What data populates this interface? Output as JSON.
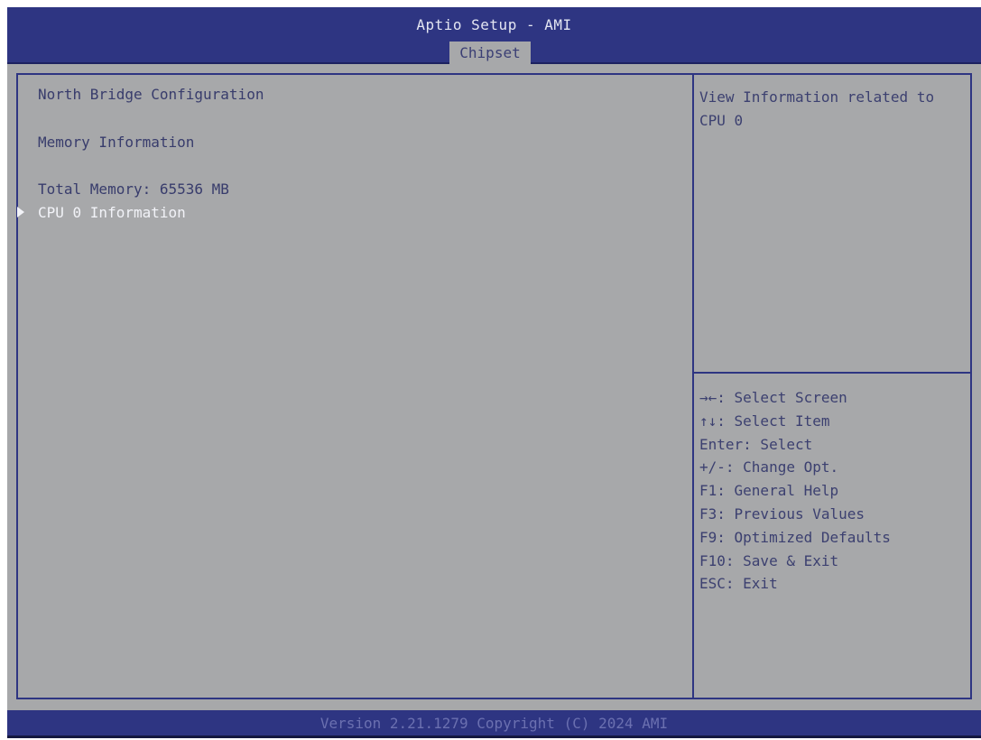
{
  "header": {
    "title": "Aptio Setup - AMI",
    "active_tab": "Chipset"
  },
  "left": {
    "items": [
      {
        "label": "North Bridge Configuration"
      },
      {
        "label": "Memory Information"
      },
      {
        "label": "Total Memory: 65536 MB"
      },
      {
        "label": "CPU 0 Information",
        "selected": true
      }
    ]
  },
  "help": {
    "text": "View Information related to CPU 0"
  },
  "keys": [
    "→←: Select Screen",
    "↑↓: Select Item",
    "Enter: Select",
    "+/-: Change Opt.",
    "F1: General Help",
    "F3: Previous Values",
    "F9: Optimized Defaults",
    "F10: Save & Exit",
    "ESC: Exit"
  ],
  "footer": {
    "text": "Version 2.21.1279 Copyright (C) 2024 AMI"
  },
  "colors": {
    "header_bg": "#2e3582",
    "panel_bg": "#a7a8aa",
    "selected_text": "#f2f3f8",
    "text": "#383c6c"
  }
}
